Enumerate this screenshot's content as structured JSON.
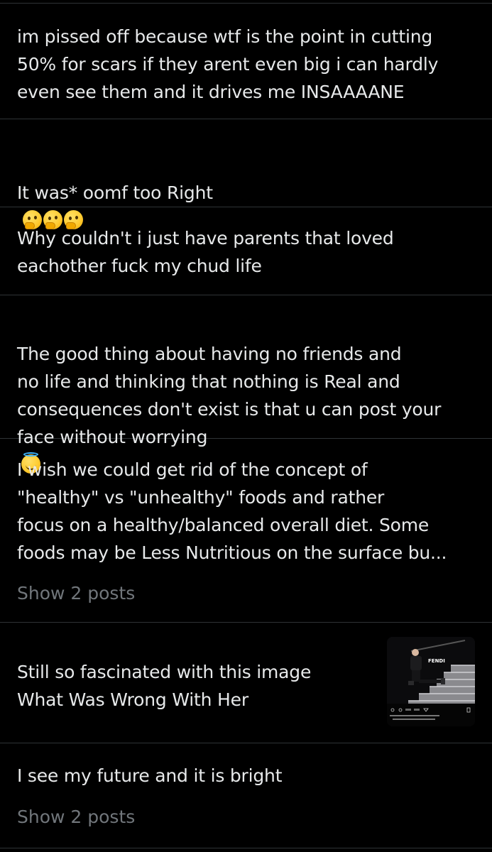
{
  "posts": [
    {
      "text": "im pissed off because wtf is the point in cutting\n50% for scars if they arent even big i can hardly\neven see them and it drives me INSAAAANE"
    },
    {
      "text": "It was* oomf too Right",
      "emojis": [
        "thinking-face",
        "thinking-face",
        "thinking-face"
      ]
    },
    {
      "text": "Why couldn't i just have parents that loved\neachother  fuck my chud life"
    },
    {
      "text": "The good thing about having no friends and\nno life and thinking that nothing is Real and\nconsequences don't exist is that u can post your\nface without worrying",
      "emojis": [
        "smiling-face-with-halo"
      ]
    },
    {
      "text": "I wish we could get rid of the concept of\n\"healthy\" vs \"unhealthy\" foods and rather\nfocus on a healthy/balanced overall diet. Some\nfoods may be Less Nutritious on the surface bu...",
      "show_more": "Show 2 posts"
    },
    {
      "text": "Still so fascinated with this image\nWhat Was Wrong With Her",
      "thumbnail": {
        "icon": "photo-thumbnail",
        "caption_text": "FENDI"
      }
    },
    {
      "text": "I see my future and it is bright",
      "show_more": "Show 2 posts"
    }
  ],
  "colors": {
    "background": "#000000",
    "text": "#e7e9ea",
    "muted": "#71767b",
    "divider": "#2f3336"
  }
}
